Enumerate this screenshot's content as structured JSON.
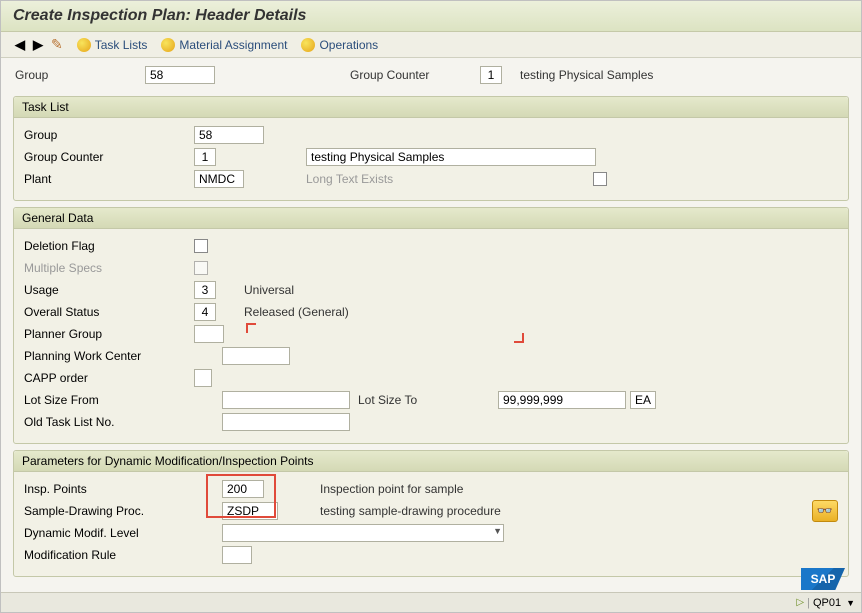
{
  "title": "Create Inspection Plan: Header Details",
  "toolbar": {
    "taskLists": "Task Lists",
    "materialAssignment": "Material Assignment",
    "operations": "Operations"
  },
  "header": {
    "groupLabel": "Group",
    "groupValue": "58",
    "groupCounterLabel": "Group Counter",
    "groupCounterValue": "1",
    "descText": "testing Physical Samples"
  },
  "taskListPanel": {
    "title": "Task List",
    "groupLabel": "Group",
    "groupValue": "58",
    "groupCounterLabel": "Group Counter",
    "groupCounterValue": "1",
    "descValue": "testing Physical Samples",
    "plantLabel": "Plant",
    "plantValue": "NMDC",
    "longTextLabel": "Long Text Exists"
  },
  "generalPanel": {
    "title": "General Data",
    "deletionFlagLabel": "Deletion Flag",
    "multipleSpecsLabel": "Multiple Specs",
    "usageLabel": "Usage",
    "usageValue": "3",
    "usageDesc": "Universal",
    "overallStatusLabel": "Overall Status",
    "overallStatusValue": "4",
    "overallStatusDesc": "Released (General)",
    "plannerGroupLabel": "Planner Group",
    "planningWorkCenterLabel": "Planning Work Center",
    "cappOrderLabel": "CAPP order",
    "lotSizeFromLabel": "Lot Size From",
    "lotSizeToLabel": "Lot Size To",
    "lotSizeToValue": "99,999,999",
    "lotUnit": "EA",
    "oldTaskListNoLabel": "Old Task List No."
  },
  "paramPanel": {
    "title": "Parameters for Dynamic Modification/Inspection Points",
    "inspPointsLabel": "Insp. Points",
    "inspPointsValue": "200",
    "inspPointsDesc": "Inspection point for sample",
    "sampleDrawingLabel": "Sample-Drawing Proc.",
    "sampleDrawingValue": "ZSDP",
    "sampleDrawingDesc": "testing sample-drawing procedure",
    "dynamicModifLabel": "Dynamic Modif. Level",
    "modificationRuleLabel": "Modification Rule"
  },
  "status": {
    "tcode": "QP01",
    "marker": "▼"
  }
}
